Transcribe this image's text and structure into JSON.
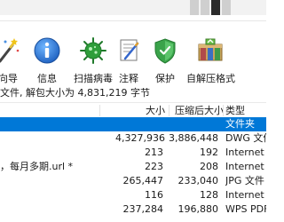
{
  "toolbar": {
    "items": [
      {
        "label": "向导",
        "icon": "wizard-icon"
      },
      {
        "label": "信息",
        "icon": "info-icon"
      },
      {
        "label": "扫描病毒",
        "icon": "virus-scan-icon"
      },
      {
        "label": "注释",
        "icon": "comment-icon"
      },
      {
        "label": "保护",
        "icon": "shield-icon"
      },
      {
        "label": "自解压格式",
        "icon": "sfx-archive-icon"
      }
    ]
  },
  "status": {
    "text": "文件, 解包大小为 4,831,219 字节"
  },
  "table": {
    "columns": {
      "size": "大小",
      "packed": "压缩后大小",
      "type": "类型"
    },
    "rows": [
      {
        "name": "",
        "size": "",
        "packed": "",
        "type": "文件夹",
        "selected": true
      },
      {
        "name": "",
        "size": "4,327,936",
        "packed": "3,886,448",
        "type": "DWG 文件",
        "selected": false
      },
      {
        "name": "",
        "size": "213",
        "packed": "192",
        "type": "Internet 快",
        "selected": false
      },
      {
        "name": "，每月多期.url *",
        "size": "223",
        "packed": "208",
        "type": "Internet 快",
        "selected": false
      },
      {
        "name": "",
        "size": "265,447",
        "packed": "233,040",
        "type": "JPG 文件",
        "selected": false
      },
      {
        "name": "",
        "size": "116",
        "packed": "128",
        "type": "Internet 快",
        "selected": false
      },
      {
        "name": "",
        "size": "237,284",
        "packed": "196,880",
        "type": "WPS PDF",
        "selected": false
      }
    ]
  },
  "colors": {
    "selection": "#0078d7",
    "virus_green": "#2e9e3a",
    "shield_green": "#3aa34a",
    "archive_tan": "#c9a25a"
  }
}
